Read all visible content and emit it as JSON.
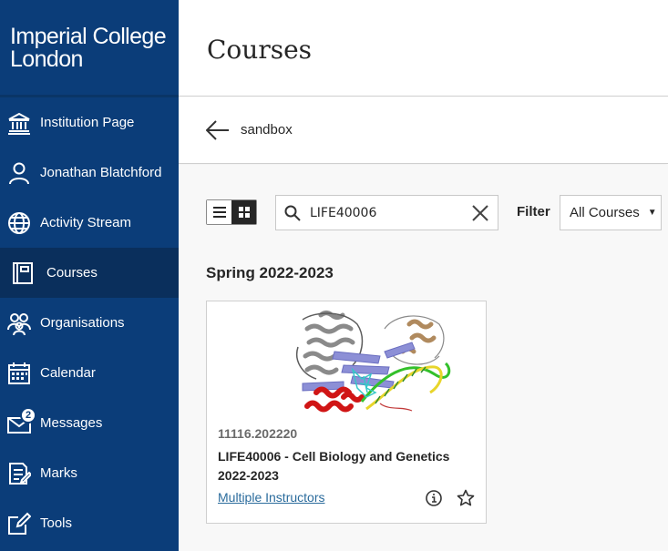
{
  "brand": {
    "line1": "Imperial College",
    "line2": "London"
  },
  "nav": [
    {
      "label": "Institution Page",
      "icon": "institution-icon"
    },
    {
      "label": "Jonathan Blatchford",
      "icon": "user-icon"
    },
    {
      "label": "Activity Stream",
      "icon": "globe-icon"
    },
    {
      "label": "Courses",
      "icon": "courses-icon",
      "active": true
    },
    {
      "label": "Organisations",
      "icon": "organisations-icon"
    },
    {
      "label": "Calendar",
      "icon": "calendar-icon"
    },
    {
      "label": "Messages",
      "icon": "envelope-icon",
      "badge": "2"
    },
    {
      "label": "Marks",
      "icon": "marks-icon"
    },
    {
      "label": "Tools",
      "icon": "tools-icon"
    }
  ],
  "page": {
    "title": "Courses"
  },
  "breadcrumb": {
    "label": "sandbox"
  },
  "toolbar": {
    "search_value": "LIFE40006",
    "filter_label": "Filter",
    "filter_value": "All Courses"
  },
  "term": "Spring 2022-2023",
  "course": {
    "id": "11116.202220",
    "name_line1": "LIFE40006 - Cell Biology and Genetics",
    "name_line2": "2022-2023",
    "instructors": "Multiple Instructors"
  },
  "colors": {
    "sidebar": "#0b3d79",
    "sidebar_active": "#0a2f5c",
    "link": "#2a6b9c"
  }
}
